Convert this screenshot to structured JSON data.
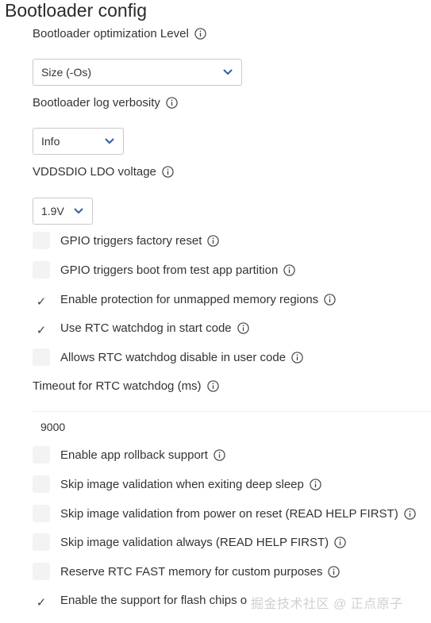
{
  "section": {
    "title": "Bootloader config"
  },
  "optimization": {
    "label": "Bootloader optimization Level",
    "value": "Size (-Os)"
  },
  "log_verbosity": {
    "label": "Bootloader log verbosity",
    "value": "Info"
  },
  "vddsdio": {
    "label": "VDDSDIO LDO voltage",
    "value": "1.9V"
  },
  "checks_a": [
    {
      "label": "GPIO triggers factory reset",
      "checked": false,
      "mark": ""
    },
    {
      "label": "GPIO triggers boot from test app partition",
      "checked": false,
      "mark": ""
    },
    {
      "label": "Enable protection for unmapped memory regions",
      "checked": true,
      "mark": "✓"
    },
    {
      "label": "Use RTC watchdog in start code",
      "checked": true,
      "mark": "✓"
    },
    {
      "label": "Allows RTC watchdog disable in user code",
      "checked": false,
      "mark": ""
    }
  ],
  "timeout": {
    "label": "Timeout for RTC watchdog (ms)",
    "value": "9000"
  },
  "checks_b": [
    {
      "label": "Enable app rollback support",
      "checked": false,
      "mark": ""
    },
    {
      "label": "Skip image validation when exiting deep sleep",
      "checked": false,
      "mark": ""
    },
    {
      "label": "Skip image validation from power on reset (READ HELP FIRST)",
      "checked": false,
      "mark": ""
    },
    {
      "label": "Skip image validation always (READ HELP FIRST)",
      "checked": false,
      "mark": ""
    },
    {
      "label": "Reserve RTC FAST memory for custom purposes",
      "checked": false,
      "mark": ""
    },
    {
      "label": "Enable the support for flash chips o",
      "checked": true,
      "mark": "✓"
    }
  ],
  "watermark": {
    "text": "掘金技术社区 @ 正点原子"
  },
  "icons": {
    "info": "info-circle-icon",
    "chevron": "chevron-down-icon",
    "check": "checkmark-icon"
  },
  "colors": {
    "chevron": "#2f5fa8",
    "text": "#333333",
    "checkbox_bg": "#f3f3f3"
  }
}
